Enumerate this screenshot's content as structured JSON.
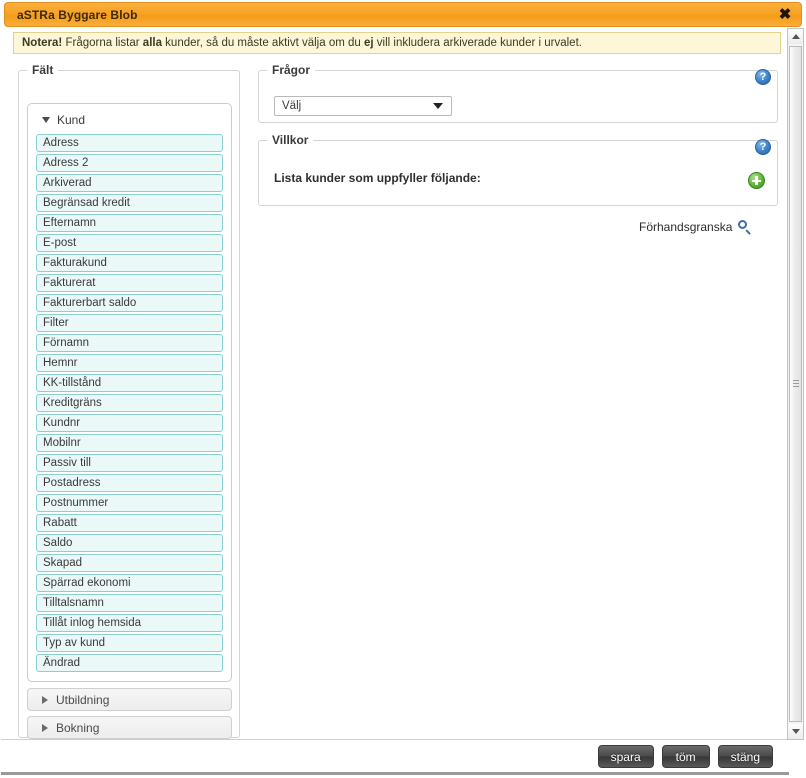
{
  "window": {
    "title": "aSTRa Byggare Blob",
    "close_icon": "close-icon",
    "close_glyph": "✖"
  },
  "notice": {
    "prefix": "Notera!",
    "text_part1": " Frågorna listar ",
    "bold1": "alla",
    "text_part2": " kunder, så du måste aktivt välja om du ",
    "bold2": "ej",
    "text_part3": " vill inkludera arkiverade kunder i urvalet."
  },
  "fields_panel": {
    "legend": "Fält",
    "group": {
      "label": "Kund",
      "expanded": true,
      "items": [
        "Adress",
        "Adress 2",
        "Arkiverad",
        "Begränsad kredit",
        "Efternamn",
        "E-post",
        "Fakturakund",
        "Fakturerat",
        "Fakturerbart saldo",
        "Filter",
        "Förnamn",
        "Hemnr",
        "KK-tillstånd",
        "Kreditgräns",
        "Kundnr",
        "Mobilnr",
        "Passiv till",
        "Postadress",
        "Postnummer",
        "Rabatt",
        "Saldo",
        "Skapad",
        "Spärrad ekonomi",
        "Tilltalsnamn",
        "Tillåt inlog hemsida",
        "Typ av kund",
        "Ändrad"
      ]
    },
    "collapsed_groups": [
      {
        "label": "Utbildning"
      },
      {
        "label": "Bokning"
      }
    ]
  },
  "questions_panel": {
    "legend": "Frågor",
    "select_value": "Välj",
    "help_icon": "help-icon",
    "help_glyph": "?"
  },
  "conditions_panel": {
    "legend": "Villkor",
    "description": "Lista kunder som uppfyller följande:",
    "help_icon": "help-icon",
    "help_glyph": "?",
    "add_icon": "add-icon"
  },
  "preview": {
    "label": "Förhandsgranska",
    "icon": "magnifier-icon"
  },
  "footer": {
    "save_label": "spara",
    "clear_label": "töm",
    "close_label": "stäng"
  },
  "colors": {
    "titlebar_accent": "#f7a325",
    "notice_bg": "#fdf6d8",
    "notice_border": "#e3d28c",
    "field_bg": "#eaf8f7",
    "field_border": "#8ccfcf",
    "help_blue": "#3d82c9",
    "add_green": "#5eb63a"
  }
}
